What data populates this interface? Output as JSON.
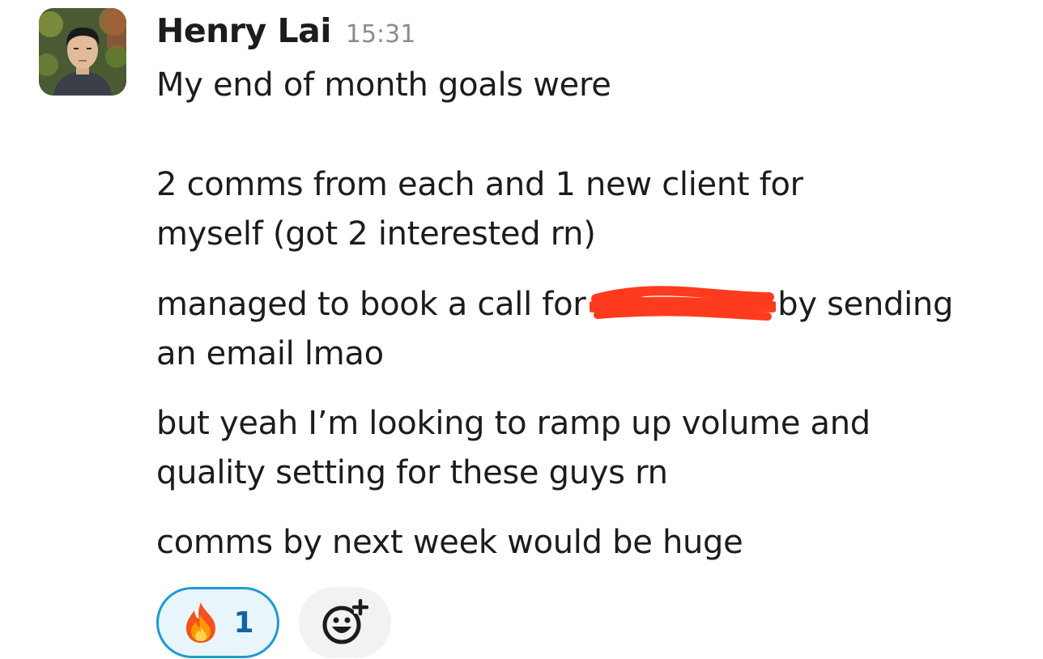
{
  "message": {
    "sender": "Henry Lai",
    "timestamp": "15:31",
    "lines": [
      "My end of month goals were",
      "2 comms from each and 1 new client for",
      "myself (got 2 interested rn)",
      "managed to book a call for",
      "by sending",
      "an email lmao",
      "but yeah I’m looking to ramp up volume and",
      "quality setting for these guys rn",
      "comms by next week would be huge"
    ]
  },
  "reactions": [
    {
      "emoji": "fire-emoji",
      "count": "1",
      "active": true
    }
  ],
  "icons": {
    "add_reaction": "add-reaction-icon"
  },
  "colors": {
    "reaction_border": "#1d9bd1",
    "reaction_bg": "#e8f5fa",
    "reaction_count": "#1264a3",
    "timestamp": "#8c8c8c",
    "redaction": "#ff3b1f"
  }
}
